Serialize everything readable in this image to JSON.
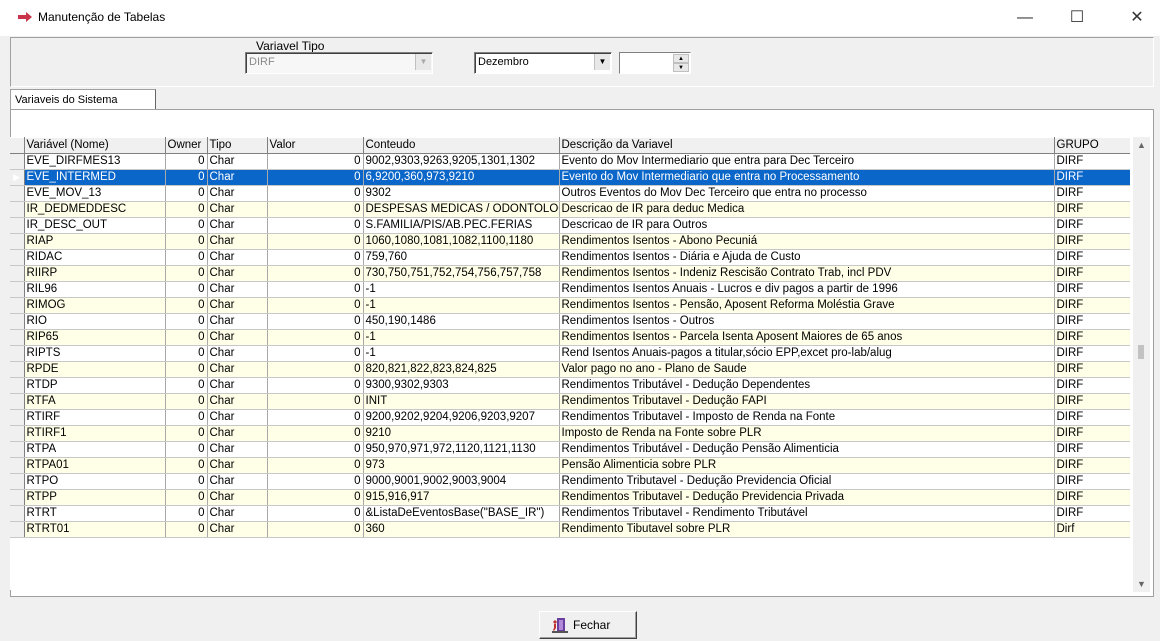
{
  "window": {
    "title": "Manutenção de Tabelas",
    "min_glyph": "—",
    "max_glyph": "☐",
    "close_glyph": "✕"
  },
  "filters": {
    "variavel_tipo_label": "Variavel Tipo",
    "variavel_tipo_value": "DIRF",
    "mes_value": "Dezembro",
    "ano_value": ""
  },
  "tab": {
    "label": "Variaveis do Sistema"
  },
  "grid": {
    "columns": [
      "Variável (Nome)",
      "Owner",
      "Tipo",
      "Valor",
      "Conteudo",
      "Descrição da Variavel",
      "GRUPO"
    ],
    "rows": [
      {
        "nome": "EVE_DIRFMES13",
        "owner": "0",
        "tipo": "Char",
        "valor": "0",
        "conteudo": "9002,9303,9263,9205,1301,1302",
        "descricao": "Evento do Mov Intermediario que entra para Dec Terceiro",
        "grupo": "DIRF"
      },
      {
        "nome": "EVE_INTERMED",
        "owner": "0",
        "tipo": "Char",
        "valor": "0",
        "conteudo": "6,9200,360,973,9210",
        "descricao": "Evento do Mov Intermediario que entra no Processamento",
        "grupo": "DIRF"
      },
      {
        "nome": "EVE_MOV_13",
        "owner": "0",
        "tipo": "Char",
        "valor": "0",
        "conteudo": "9302",
        "descricao": "Outros Eventos do Mov Dec Terceiro que entra no processo",
        "grupo": "DIRF"
      },
      {
        "nome": "IR_DEDMEDDESC",
        "owner": "0",
        "tipo": "Char",
        "valor": "0",
        "conteudo": "DESPESAS MEDICAS / ODONTOLOGICAS",
        "descricao": "Descricao de IR para deduc Medica",
        "grupo": "DIRF"
      },
      {
        "nome": "IR_DESC_OUT",
        "owner": "0",
        "tipo": "Char",
        "valor": "0",
        "conteudo": "S.FAMILIA/PIS/AB.PEC.FERIAS",
        "descricao": "Descricao de IR para Outros",
        "grupo": "DIRF"
      },
      {
        "nome": "RIAP",
        "owner": "0",
        "tipo": "Char",
        "valor": "0",
        "conteudo": "1060,1080,1081,1082,1100,1180",
        "descricao": "Rendimentos Isentos - Abono Pecuniá",
        "grupo": "DIRF"
      },
      {
        "nome": "RIDAC",
        "owner": "0",
        "tipo": "Char",
        "valor": "0",
        "conteudo": "759,760",
        "descricao": "Rendimentos Isentos - Diária e Ajuda de Custo",
        "grupo": "DIRF"
      },
      {
        "nome": "RIIRP",
        "owner": "0",
        "tipo": "Char",
        "valor": "0",
        "conteudo": "730,750,751,752,754,756,757,758",
        "descricao": "Rendimentos Isentos - Indeniz Rescisão Contrato Trab, incl PDV",
        "grupo": "DIRF"
      },
      {
        "nome": "RIL96",
        "owner": "0",
        "tipo": "Char",
        "valor": "0",
        "conteudo": "-1",
        "descricao": "Rendimentos Isentos Anuais - Lucros e div pagos a partir de 1996",
        "grupo": "DIRF"
      },
      {
        "nome": "RIMOG",
        "owner": "0",
        "tipo": "Char",
        "valor": "0",
        "conteudo": "-1",
        "descricao": "Rendimentos Isentos - Pensão, Aposent Reforma Moléstia Grave",
        "grupo": "DIRF"
      },
      {
        "nome": "RIO",
        "owner": "0",
        "tipo": "Char",
        "valor": "0",
        "conteudo": "450,190,1486",
        "descricao": "Rendimentos Isentos - Outros",
        "grupo": "DIRF"
      },
      {
        "nome": "RIP65",
        "owner": "0",
        "tipo": "Char",
        "valor": "0",
        "conteudo": "-1",
        "descricao": "Rendimentos Isentos - Parcela Isenta Aposent Maiores de 65 anos",
        "grupo": "DIRF"
      },
      {
        "nome": "RIPTS",
        "owner": "0",
        "tipo": "Char",
        "valor": "0",
        "conteudo": "-1",
        "descricao": "Rend Isentos Anuais-pagos a titular,sócio EPP,excet pro-lab/alug",
        "grupo": "DIRF"
      },
      {
        "nome": "RPDE",
        "owner": "0",
        "tipo": "Char",
        "valor": "0",
        "conteudo": "820,821,822,823,824,825",
        "descricao": "Valor pago no ano - Plano de Saude",
        "grupo": "DIRF"
      },
      {
        "nome": "RTDP",
        "owner": "0",
        "tipo": "Char",
        "valor": "0",
        "conteudo": "9300,9302,9303",
        "descricao": "Rendimentos Tributável - Dedução Dependentes",
        "grupo": "DIRF"
      },
      {
        "nome": "RTFA",
        "owner": "0",
        "tipo": "Char",
        "valor": "0",
        "conteudo": "INIT",
        "descricao": "Rendimentos Tributavel - Dedução FAPI",
        "grupo": "DIRF"
      },
      {
        "nome": "RTIRF",
        "owner": "0",
        "tipo": "Char",
        "valor": "0",
        "conteudo": "9200,9202,9204,9206,9203,9207",
        "descricao": "Rendimentos Tributavel - Imposto de Renda na Fonte",
        "grupo": "DIRF"
      },
      {
        "nome": "RTIRF1",
        "owner": "0",
        "tipo": "Char",
        "valor": "0",
        "conteudo": "9210",
        "descricao": "Imposto de Renda na Fonte sobre PLR",
        "grupo": "DIRF"
      },
      {
        "nome": "RTPA",
        "owner": "0",
        "tipo": "Char",
        "valor": "0",
        "conteudo": "950,970,971,972,1120,1121,1130",
        "descricao": "Rendimentos Tributável - Dedução Pensão Alimenticia",
        "grupo": "DIRF"
      },
      {
        "nome": "RTPA01",
        "owner": "0",
        "tipo": "Char",
        "valor": "0",
        "conteudo": "973",
        "descricao": "Pensão Alimenticia sobre PLR",
        "grupo": "DIRF"
      },
      {
        "nome": "RTPO",
        "owner": "0",
        "tipo": "Char",
        "valor": "0",
        "conteudo": "9000,9001,9002,9003,9004",
        "descricao": "Rendimento Tributavel - Dedução Previdencia Oficial",
        "grupo": "DIRF"
      },
      {
        "nome": "RTPP",
        "owner": "0",
        "tipo": "Char",
        "valor": "0",
        "conteudo": "915,916,917",
        "descricao": "Rendimentos Tributavel - Dedução Previdencia Privada",
        "grupo": "DIRF"
      },
      {
        "nome": "RTRT",
        "owner": "0",
        "tipo": "Char",
        "valor": "0",
        "conteudo": "&ListaDeEventosBase(\"BASE_IR\")",
        "descricao": "Rendimentos Tributavel - Rendimento Tributável",
        "grupo": "DIRF"
      },
      {
        "nome": "RTRT01",
        "owner": "0",
        "tipo": "Char",
        "valor": "0",
        "conteudo": "360",
        "descricao": "Rendimento Tibutavel sobre PLR",
        "grupo": "Dirf"
      }
    ],
    "selected_index": 1
  },
  "buttons": {
    "fechar": "Fechar"
  },
  "colors": {
    "selection": "#0a66c8",
    "row_alt": "#ffffe8",
    "title_icon": "#d03030"
  }
}
